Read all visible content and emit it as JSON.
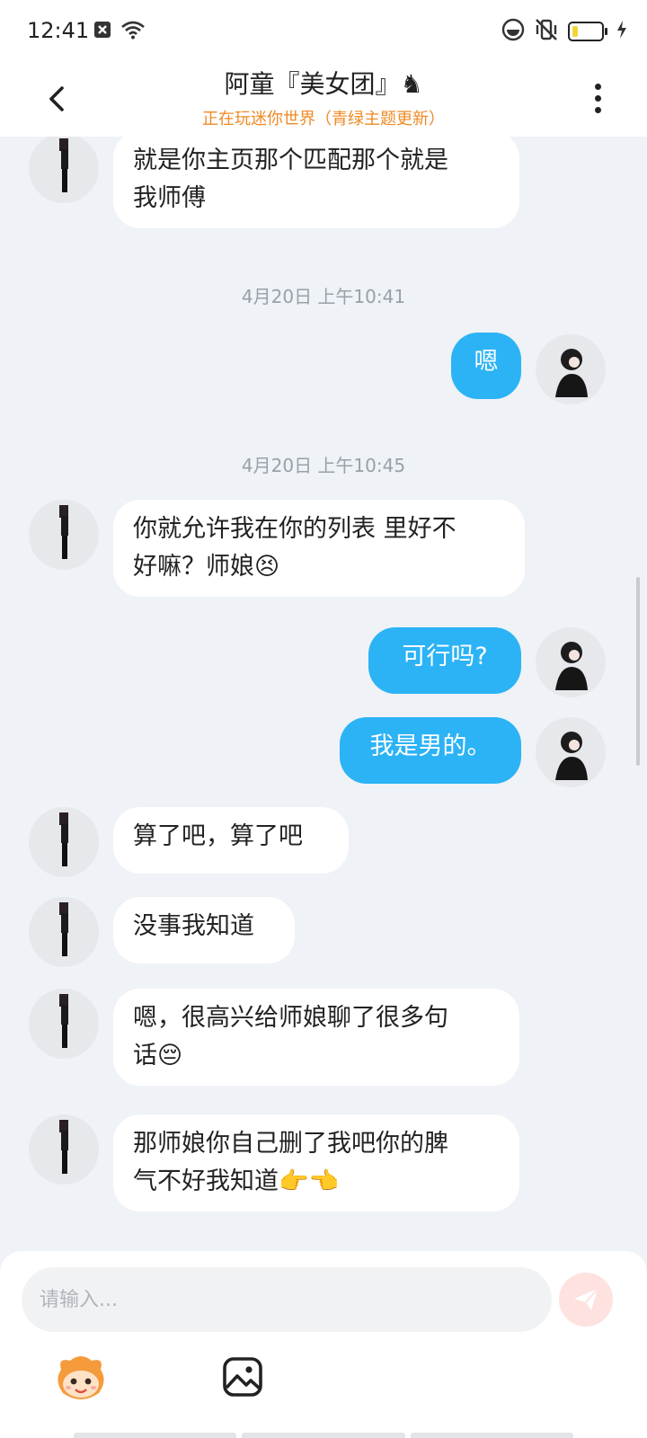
{
  "status_bar": {
    "time": "12:41",
    "icons": [
      "notification-x-icon",
      "wifi-icon",
      "do-not-disturb-icon",
      "vibrate-off-icon",
      "battery-icon",
      "charging-icon"
    ],
    "battery_level": 0.2
  },
  "header": {
    "title": "阿童『美女团』♞",
    "subtitle": "正在玩迷你世界（青绿主题更新）",
    "subtitle_color": "#f08a24"
  },
  "messages": [
    {
      "side": "in",
      "lines": [
        "就是你主页那个匹配那个就是",
        "我师傅"
      ]
    },
    {
      "type": "timestamp",
      "text": "4月20日 上午10:41"
    },
    {
      "side": "out",
      "lines": [
        "嗯"
      ]
    },
    {
      "type": "timestamp",
      "text": "4月20日 上午10:45"
    },
    {
      "side": "in",
      "lines": [
        "你就允许我在你的列表 里好不",
        "好嘛？师娘😣"
      ]
    },
    {
      "side": "out",
      "lines": [
        "可行吗?"
      ]
    },
    {
      "side": "out",
      "lines": [
        "我是男的。"
      ]
    },
    {
      "side": "in",
      "lines": [
        "算了吧，算了吧"
      ]
    },
    {
      "side": "in",
      "lines": [
        "没事我知道"
      ]
    },
    {
      "side": "in",
      "lines": [
        "嗯，很高兴给师娘聊了很多句",
        "话😔"
      ]
    },
    {
      "side": "in",
      "lines": [
        "那师娘你自己删了我吧你的脾",
        "气不好我知道👉👈"
      ]
    }
  ],
  "composer": {
    "placeholder": "请输入...",
    "send_icon": "send-icon",
    "toolbar_icons": [
      "mascot-emoji-icon",
      "image-icon"
    ]
  },
  "colors": {
    "outgoing_bubble": "#2cb3f5",
    "incoming_bubble": "#ffffff",
    "background": "#eff2f6",
    "send_button": "#fde2e0"
  }
}
